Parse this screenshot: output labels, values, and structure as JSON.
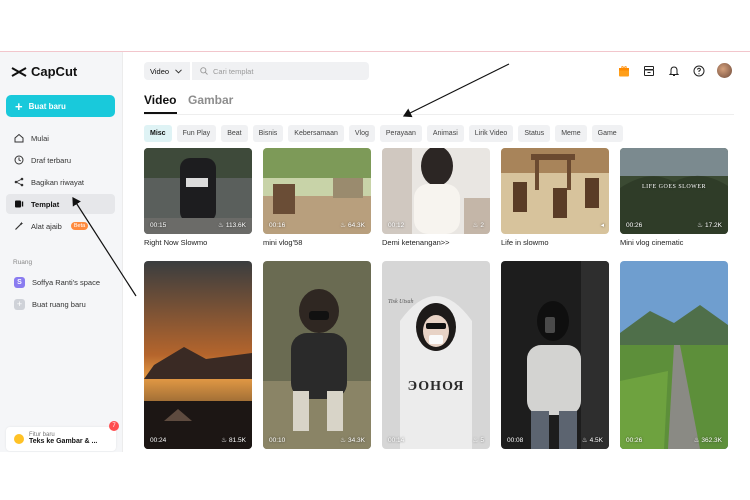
{
  "app": {
    "name": "CapCut"
  },
  "sidebar": {
    "new_button": "Buat baru",
    "items": [
      {
        "label": "Mulai",
        "icon": "home-icon"
      },
      {
        "label": "Draf terbaru",
        "icon": "clock-icon"
      },
      {
        "label": "Bagikan riwayat",
        "icon": "share-icon"
      },
      {
        "label": "Templat",
        "icon": "template-icon",
        "active": true
      },
      {
        "label": "Alat ajaib",
        "icon": "magic-wand-icon",
        "badge": "Beta"
      }
    ],
    "section_label": "Ruang",
    "spaces": [
      {
        "label": "Soffya Ranti's space",
        "avatar_letter": "S"
      },
      {
        "label": "Buat ruang baru"
      }
    ],
    "feature": {
      "label": "Fitur baru",
      "title": "Teks ke Gambar & ...",
      "count": "7"
    }
  },
  "header": {
    "dropdown_value": "Video",
    "search_placeholder": "Cari templat"
  },
  "tabs": [
    {
      "label": "Video",
      "active": true
    },
    {
      "label": "Gambar",
      "active": false
    }
  ],
  "categories": [
    {
      "label": "Misc",
      "active": true
    },
    {
      "label": "Fun Play"
    },
    {
      "label": "Beat"
    },
    {
      "label": "Bisnis"
    },
    {
      "label": "Kebersamaan"
    },
    {
      "label": "Vlog"
    },
    {
      "label": "Perayaan"
    },
    {
      "label": "Animasi"
    },
    {
      "label": "Lirik Video"
    },
    {
      "label": "Status"
    },
    {
      "label": "Meme"
    },
    {
      "label": "Game"
    }
  ],
  "templates_row1": [
    {
      "title": "Right Now Slowmo",
      "duration": "00:15",
      "likes": "113.6K"
    },
    {
      "title": "mini vlog'58",
      "duration": "00:16",
      "likes": "64.3K"
    },
    {
      "title": "Demi ketenangan>>",
      "duration": "00:12",
      "likes": "2"
    },
    {
      "title": "Life in slowmo",
      "duration": "",
      "likes": ""
    },
    {
      "title": "Mini vlog cinematic",
      "duration": "00:26",
      "likes": "17.2K",
      "overlay_text": "LIFE GOES SLOWER"
    }
  ],
  "templates_row2": [
    {
      "duration": "00:24",
      "likes": "81.5K"
    },
    {
      "duration": "00:10",
      "likes": "34.3K"
    },
    {
      "duration": "00:14",
      "likes": "5",
      "overlay_text": "Tisk Utsah",
      "shirt_text": "ЭОНОЯ"
    },
    {
      "duration": "00:08",
      "likes": "4.5K"
    },
    {
      "duration": "00:26",
      "likes": "362.3K"
    }
  ],
  "colors": {
    "accent": "#19c9db",
    "beta": "#ff8a3d",
    "notification": "#ff4d4f",
    "gift": "#ff9f1a"
  }
}
